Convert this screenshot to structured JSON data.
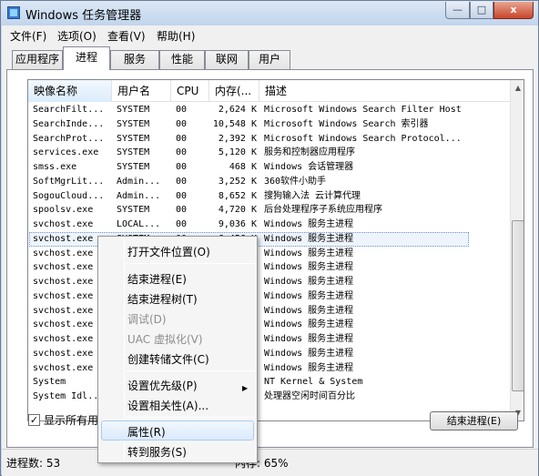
{
  "window": {
    "title": "Windows 任务管理器"
  },
  "window_buttons": {
    "minimize": "—",
    "maximize": "□",
    "close": "x"
  },
  "menu": [
    "文件(F)",
    "选项(O)",
    "查看(V)",
    "帮助(H)"
  ],
  "tabs": [
    "应用程序",
    "进程",
    "服务",
    "性能",
    "联网",
    "用户"
  ],
  "active_tab": "进程",
  "columns": [
    "映像名称",
    "用户名",
    "CPU",
    "内存(...",
    "描述"
  ],
  "rows": [
    [
      "SearchFilt...",
      "SYSTEM",
      "00",
      "2,624 K",
      "Microsoft Windows Search Filter Host"
    ],
    [
      "SearchInde...",
      "SYSTEM",
      "00",
      "10,548 K",
      "Microsoft Windows Search 索引器"
    ],
    [
      "SearchProt...",
      "SYSTEM",
      "00",
      "2,392 K",
      "Microsoft Windows Search Protocol..."
    ],
    [
      "services.exe",
      "SYSTEM",
      "00",
      "5,120 K",
      "服务和控制器应用程序"
    ],
    [
      "smss.exe",
      "SYSTEM",
      "00",
      "468 K",
      "Windows 会话管理器"
    ],
    [
      "SoftMgrLit...",
      "Admin...",
      "00",
      "3,252 K",
      "360软件小助手"
    ],
    [
      "SogouCloud...",
      "Admin...",
      "00",
      "8,652 K",
      "搜狗输入法 云计算代理"
    ],
    [
      "spoolsv.exe",
      "SYSTEM",
      "00",
      "4,720 K",
      "后台处理程序子系统应用程序"
    ],
    [
      "svchost.exe",
      "LOCAL...",
      "00",
      "9,036 K",
      "Windows 服务主进程"
    ],
    [
      "svchost.exe",
      "SYSTEM",
      "00",
      "6,456 K",
      "Windows 服务主进程"
    ],
    [
      "svchost.exe",
      "",
      "",
      "",
      "Windows 服务主进程"
    ],
    [
      "svchost.exe",
      "",
      "",
      "",
      "Windows 服务主进程"
    ],
    [
      "svchost.exe",
      "",
      "",
      "",
      "Windows 服务主进程"
    ],
    [
      "svchost.exe",
      "",
      "",
      "",
      "Windows 服务主进程"
    ],
    [
      "svchost.exe",
      "",
      "",
      "",
      "Windows 服务主进程"
    ],
    [
      "svchost.exe",
      "",
      "",
      "",
      "Windows 服务主进程"
    ],
    [
      "svchost.exe",
      "",
      "",
      "",
      "Windows 服务主进程"
    ],
    [
      "svchost.exe",
      "",
      "",
      "",
      "Windows 服务主进程"
    ],
    [
      "svchost.exe",
      "",
      "",
      "",
      "Windows 服务主进程"
    ],
    [
      "System",
      "",
      "",
      "",
      "NT Kernel & System"
    ],
    [
      "System Idl...",
      "",
      "",
      "",
      "处理器空闲时间百分比"
    ]
  ],
  "selected_row": 9,
  "show_all_label": "显示所有用",
  "end_process_button": "结束进程(E)",
  "status": {
    "processes": "进程数: 53",
    "memory": "内存: 65%"
  },
  "context_menu": {
    "open_location": "打开文件位置(O)",
    "end_process": "结束进程(E)",
    "end_tree": "结束进程树(T)",
    "debug": "调试(D)",
    "uac": "UAC 虚拟化(V)",
    "dump": "创建转储文件(C)",
    "priority": "设置优先级(P)",
    "affinity": "设置相关性(A)...",
    "properties": "属性(R)",
    "goto_service": "转到服务(S)"
  }
}
